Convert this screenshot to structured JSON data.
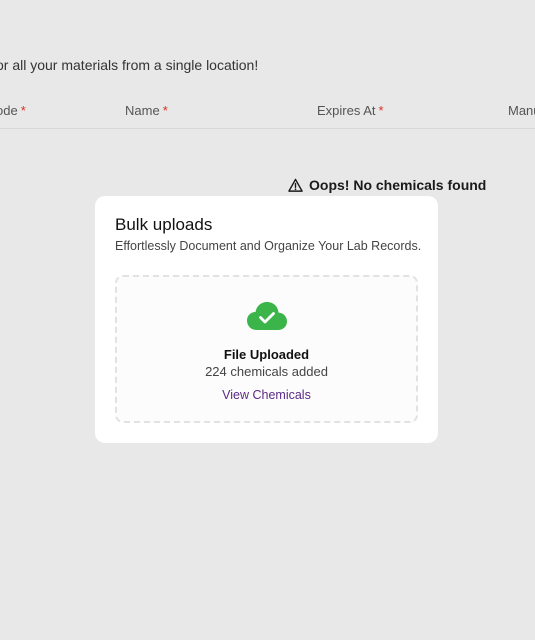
{
  "page": {
    "subtitle": "or all your materials from a single location!"
  },
  "table": {
    "columns": [
      {
        "label": "ode",
        "required": "*"
      },
      {
        "label": "Name",
        "required": "*"
      },
      {
        "label": "Expires At",
        "required": "*"
      },
      {
        "label": "Manu"
      }
    ],
    "empty_message": "Oops! No chemicals found"
  },
  "modal": {
    "title": "Bulk uploads",
    "description": "Effortlessly Document and Organize Your Lab Records.",
    "status": "File Uploaded",
    "count_text": "224 chemicals added",
    "view_link": "View Chemicals",
    "icon": "cloud-check-icon",
    "icon_color": "#3bb54a",
    "link_color": "#5b2a86"
  },
  "icons": {
    "warning": "warning-triangle-icon"
  }
}
